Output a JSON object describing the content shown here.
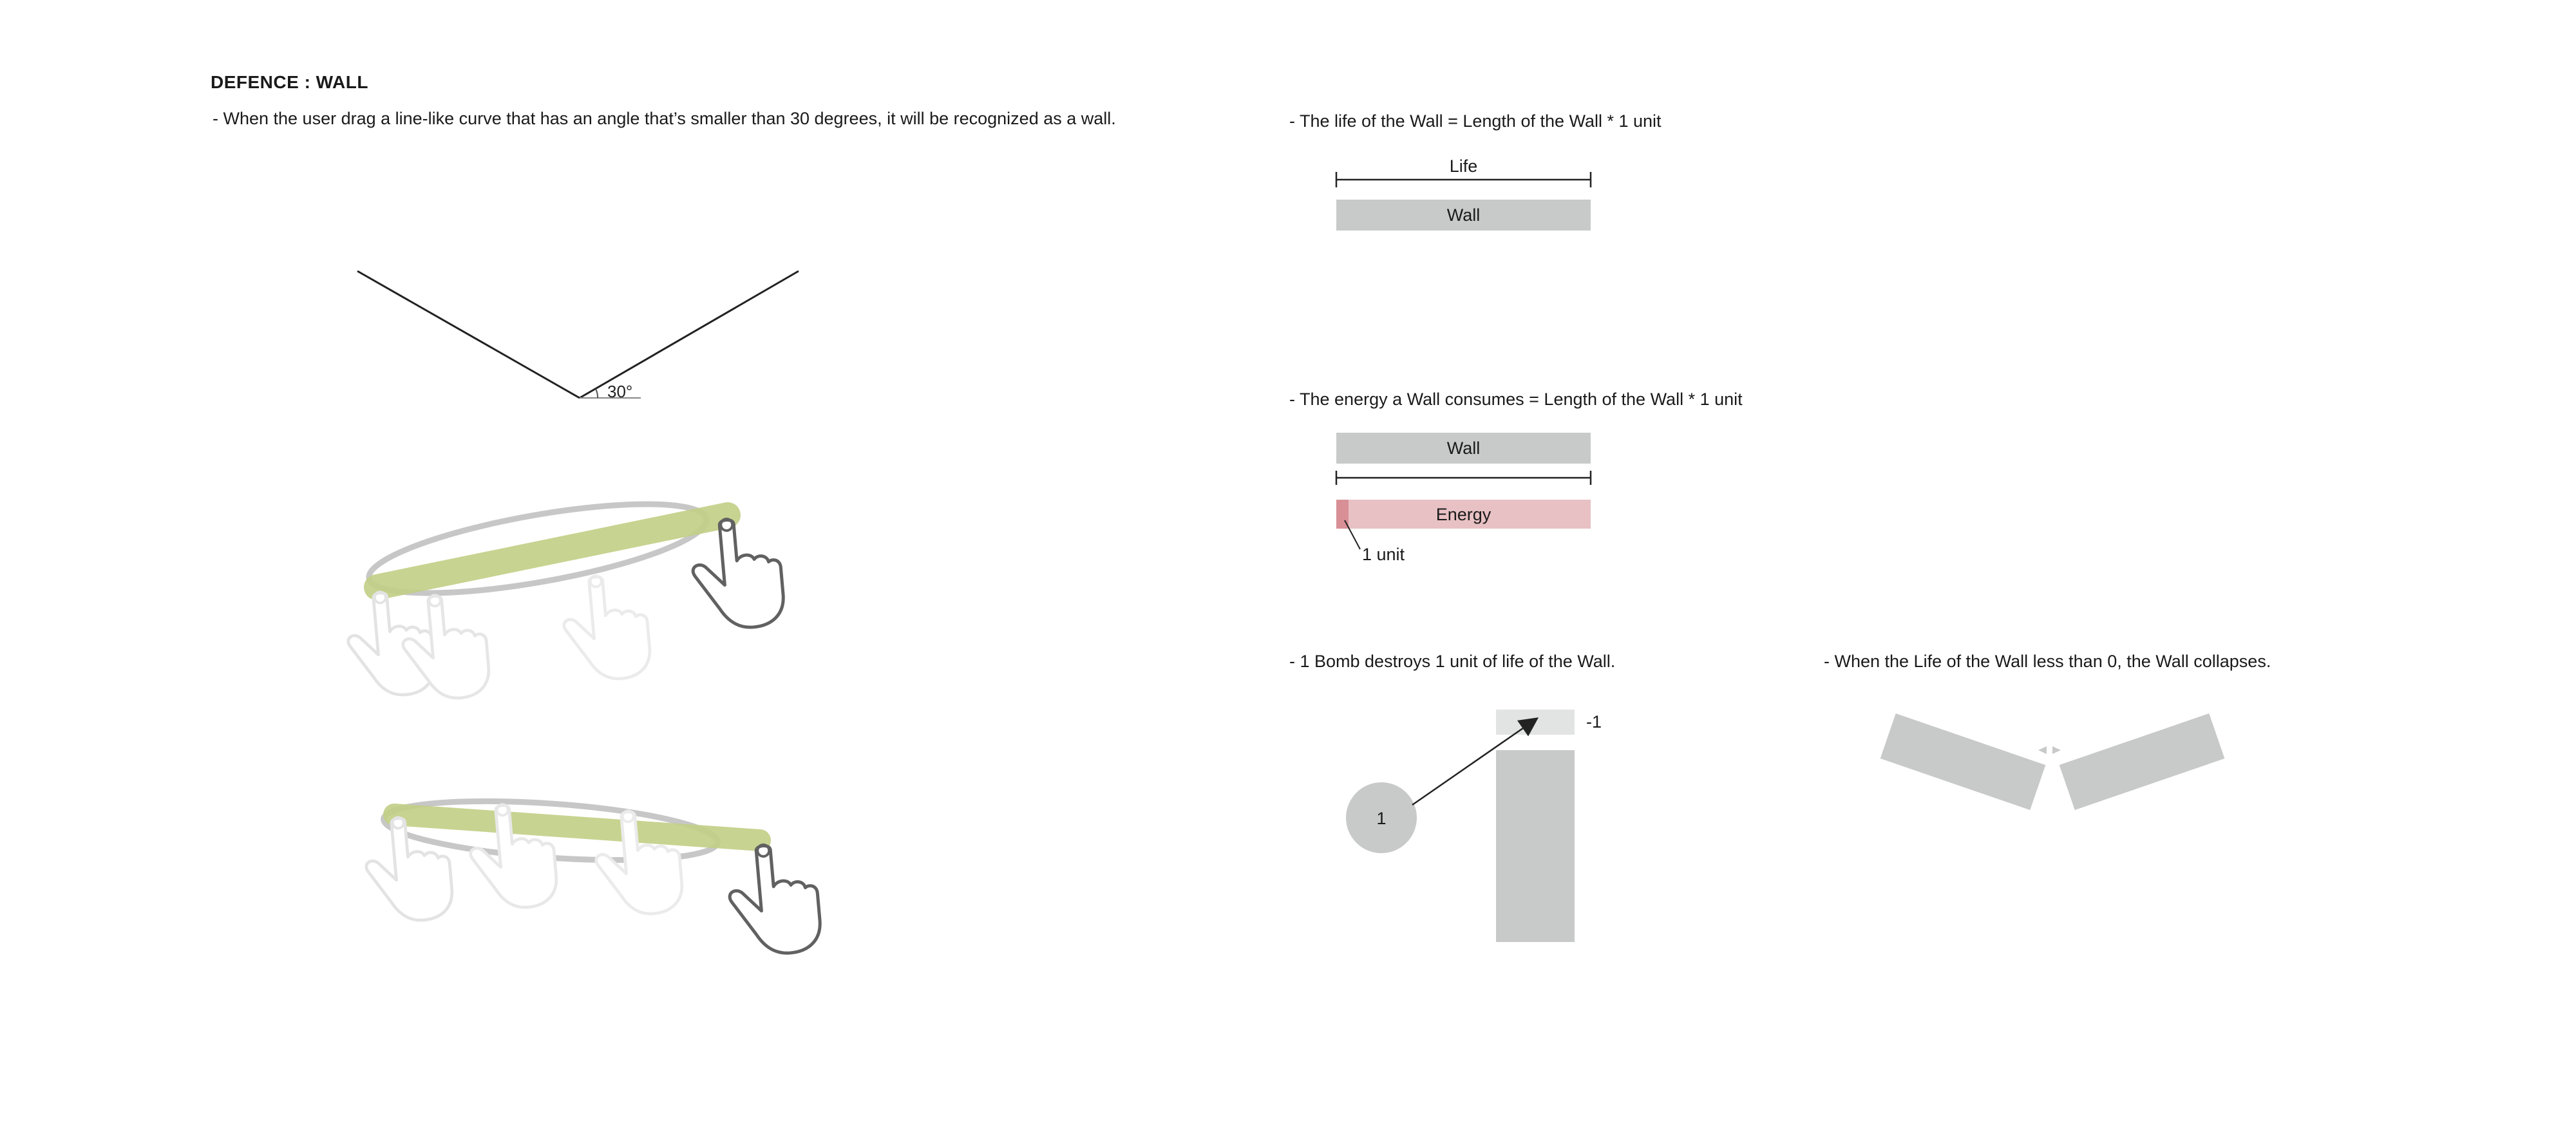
{
  "title": "DEFENCE :  WALL",
  "notes": {
    "gesture_rule": "-  When the user drag a line-like curve that has an angle that’s smaller than 30 degrees, it will be recognized as a wall.",
    "life_rule": "-  The life of the Wall = Length of the Wall * 1 unit",
    "energy_rule": "-  The energy a Wall consumes = Length of the Wall * 1 unit",
    "bomb_rule": "-  1 Bomb destroys 1 unit of life of the Wall.",
    "collapse_rule": "-  When the Life of the Wall less than 0, the Wall collapses."
  },
  "angle_diagram": {
    "angle_label": "30°"
  },
  "life_diagram": {
    "dimension_label": "Life",
    "wall_label": "Wall"
  },
  "energy_diagram": {
    "wall_label": "Wall",
    "energy_label": "Energy",
    "unit_label": "1 unit"
  },
  "bomb_diagram": {
    "bomb_label": "1",
    "damage_label": "-1"
  },
  "colors": {
    "wall_gray": "#c8c9c9",
    "light_gray": "#e2e3e3",
    "energy_pink": "#e8c1c4",
    "energy_unit": "#d88f96",
    "stroke_green": "#c2cf85",
    "line": "#333333"
  }
}
